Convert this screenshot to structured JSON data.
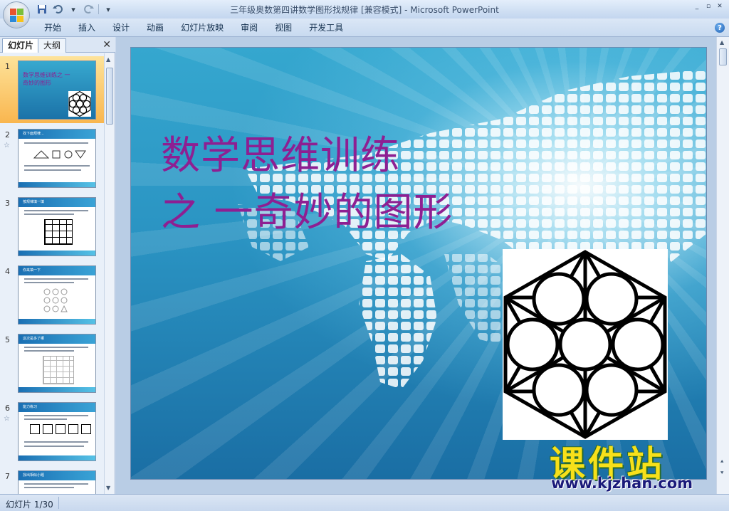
{
  "window": {
    "title": "三年级奥数第四讲数学图形找规律 [兼容模式] - Microsoft PowerPoint",
    "controls": [
      "_",
      "▫",
      "✕"
    ]
  },
  "qat": {
    "save_icon": "save-icon",
    "undo_icon": "undo-icon",
    "redo_icon": "redo-icon"
  },
  "ribbon": {
    "tabs": [
      "开始",
      "插入",
      "设计",
      "动画",
      "幻灯片放映",
      "审阅",
      "视图",
      "开发工具"
    ],
    "help": "?"
  },
  "panel": {
    "tab_slides": "幻灯片",
    "tab_outline": "大纲",
    "close": "✕",
    "thumbnails": [
      {
        "num": "1",
        "title": "数学思维训练之 一奇妙的图形",
        "star": ""
      },
      {
        "num": "2",
        "title": "找下面规律...",
        "star": "☆"
      },
      {
        "num": "3",
        "title": "按规律填一填",
        "star": ""
      },
      {
        "num": "4",
        "title": "你来填一下",
        "star": ""
      },
      {
        "num": "5",
        "title": "这次是多了哪",
        "star": ""
      },
      {
        "num": "6",
        "title": "能力练习",
        "star": "☆"
      },
      {
        "num": "7",
        "title": "找出相似小题",
        "star": ""
      }
    ]
  },
  "slide": {
    "title_line1": "数学思维训练",
    "title_line2": "之 一奇妙的图形"
  },
  "watermark": {
    "brand": "课件站",
    "url": "www.kjzhan.com"
  },
  "status": {
    "slide_counter": "幻灯片 1/30"
  },
  "colors": {
    "title": "#8e1f92",
    "slide_blue": "#2a93c2",
    "selected_thumb": "#f9b64f"
  }
}
